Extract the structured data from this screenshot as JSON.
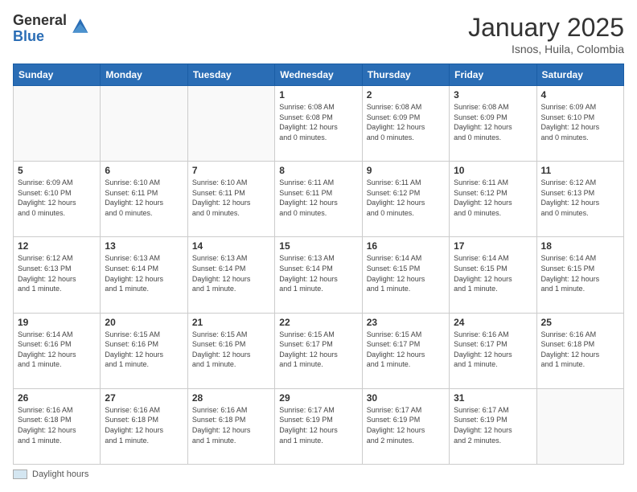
{
  "header": {
    "logo_general": "General",
    "logo_blue": "Blue",
    "title": "January 2025",
    "location": "Isnos, Huila, Colombia"
  },
  "days_of_week": [
    "Sunday",
    "Monday",
    "Tuesday",
    "Wednesday",
    "Thursday",
    "Friday",
    "Saturday"
  ],
  "weeks": [
    [
      {
        "day": "",
        "info": ""
      },
      {
        "day": "",
        "info": ""
      },
      {
        "day": "",
        "info": ""
      },
      {
        "day": "1",
        "info": "Sunrise: 6:08 AM\nSunset: 6:08 PM\nDaylight: 12 hours\nand 0 minutes."
      },
      {
        "day": "2",
        "info": "Sunrise: 6:08 AM\nSunset: 6:09 PM\nDaylight: 12 hours\nand 0 minutes."
      },
      {
        "day": "3",
        "info": "Sunrise: 6:08 AM\nSunset: 6:09 PM\nDaylight: 12 hours\nand 0 minutes."
      },
      {
        "day": "4",
        "info": "Sunrise: 6:09 AM\nSunset: 6:10 PM\nDaylight: 12 hours\nand 0 minutes."
      }
    ],
    [
      {
        "day": "5",
        "info": "Sunrise: 6:09 AM\nSunset: 6:10 PM\nDaylight: 12 hours\nand 0 minutes."
      },
      {
        "day": "6",
        "info": "Sunrise: 6:10 AM\nSunset: 6:11 PM\nDaylight: 12 hours\nand 0 minutes."
      },
      {
        "day": "7",
        "info": "Sunrise: 6:10 AM\nSunset: 6:11 PM\nDaylight: 12 hours\nand 0 minutes."
      },
      {
        "day": "8",
        "info": "Sunrise: 6:11 AM\nSunset: 6:11 PM\nDaylight: 12 hours\nand 0 minutes."
      },
      {
        "day": "9",
        "info": "Sunrise: 6:11 AM\nSunset: 6:12 PM\nDaylight: 12 hours\nand 0 minutes."
      },
      {
        "day": "10",
        "info": "Sunrise: 6:11 AM\nSunset: 6:12 PM\nDaylight: 12 hours\nand 0 minutes."
      },
      {
        "day": "11",
        "info": "Sunrise: 6:12 AM\nSunset: 6:13 PM\nDaylight: 12 hours\nand 0 minutes."
      }
    ],
    [
      {
        "day": "12",
        "info": "Sunrise: 6:12 AM\nSunset: 6:13 PM\nDaylight: 12 hours\nand 1 minute."
      },
      {
        "day": "13",
        "info": "Sunrise: 6:13 AM\nSunset: 6:14 PM\nDaylight: 12 hours\nand 1 minute."
      },
      {
        "day": "14",
        "info": "Sunrise: 6:13 AM\nSunset: 6:14 PM\nDaylight: 12 hours\nand 1 minute."
      },
      {
        "day": "15",
        "info": "Sunrise: 6:13 AM\nSunset: 6:14 PM\nDaylight: 12 hours\nand 1 minute."
      },
      {
        "day": "16",
        "info": "Sunrise: 6:14 AM\nSunset: 6:15 PM\nDaylight: 12 hours\nand 1 minute."
      },
      {
        "day": "17",
        "info": "Sunrise: 6:14 AM\nSunset: 6:15 PM\nDaylight: 12 hours\nand 1 minute."
      },
      {
        "day": "18",
        "info": "Sunrise: 6:14 AM\nSunset: 6:15 PM\nDaylight: 12 hours\nand 1 minute."
      }
    ],
    [
      {
        "day": "19",
        "info": "Sunrise: 6:14 AM\nSunset: 6:16 PM\nDaylight: 12 hours\nand 1 minute."
      },
      {
        "day": "20",
        "info": "Sunrise: 6:15 AM\nSunset: 6:16 PM\nDaylight: 12 hours\nand 1 minute."
      },
      {
        "day": "21",
        "info": "Sunrise: 6:15 AM\nSunset: 6:16 PM\nDaylight: 12 hours\nand 1 minute."
      },
      {
        "day": "22",
        "info": "Sunrise: 6:15 AM\nSunset: 6:17 PM\nDaylight: 12 hours\nand 1 minute."
      },
      {
        "day": "23",
        "info": "Sunrise: 6:15 AM\nSunset: 6:17 PM\nDaylight: 12 hours\nand 1 minute."
      },
      {
        "day": "24",
        "info": "Sunrise: 6:16 AM\nSunset: 6:17 PM\nDaylight: 12 hours\nand 1 minute."
      },
      {
        "day": "25",
        "info": "Sunrise: 6:16 AM\nSunset: 6:18 PM\nDaylight: 12 hours\nand 1 minute."
      }
    ],
    [
      {
        "day": "26",
        "info": "Sunrise: 6:16 AM\nSunset: 6:18 PM\nDaylight: 12 hours\nand 1 minute."
      },
      {
        "day": "27",
        "info": "Sunrise: 6:16 AM\nSunset: 6:18 PM\nDaylight: 12 hours\nand 1 minute."
      },
      {
        "day": "28",
        "info": "Sunrise: 6:16 AM\nSunset: 6:18 PM\nDaylight: 12 hours\nand 1 minute."
      },
      {
        "day": "29",
        "info": "Sunrise: 6:17 AM\nSunset: 6:19 PM\nDaylight: 12 hours\nand 1 minute."
      },
      {
        "day": "30",
        "info": "Sunrise: 6:17 AM\nSunset: 6:19 PM\nDaylight: 12 hours\nand 2 minutes."
      },
      {
        "day": "31",
        "info": "Sunrise: 6:17 AM\nSunset: 6:19 PM\nDaylight: 12 hours\nand 2 minutes."
      },
      {
        "day": "",
        "info": ""
      }
    ]
  ],
  "footer": {
    "label": "Daylight hours"
  }
}
